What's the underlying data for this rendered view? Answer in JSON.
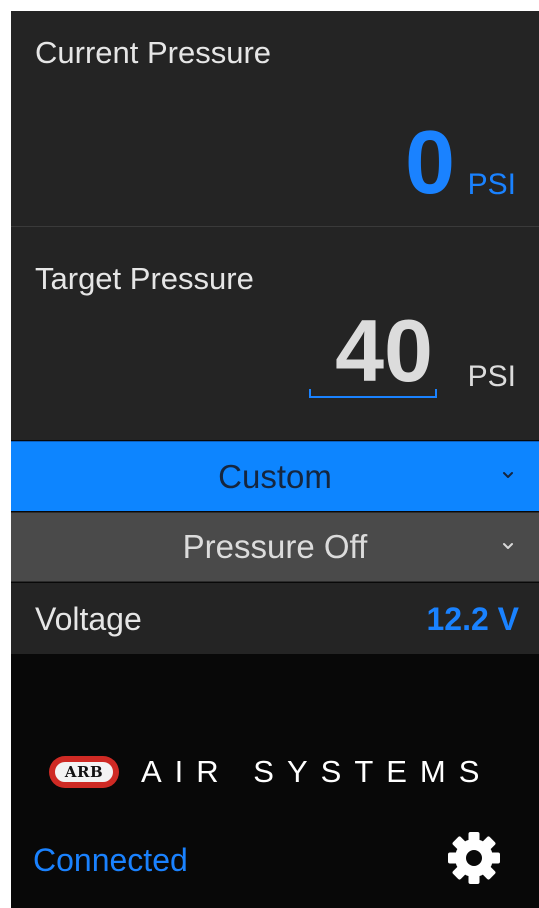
{
  "current_pressure": {
    "label": "Current Pressure",
    "value": "0",
    "unit": "PSI"
  },
  "target_pressure": {
    "label": "Target Pressure",
    "value": "40",
    "unit": "PSI"
  },
  "preset_dropdown": {
    "selected": "Custom",
    "icon": "chevron-down-icon"
  },
  "mode_dropdown": {
    "selected": "Pressure Off",
    "icon": "chevron-down-icon"
  },
  "voltage": {
    "label": "Voltage",
    "value": "12.2 V"
  },
  "brand": {
    "badge": "ARB",
    "text": "AIR SYSTEMS"
  },
  "connection": {
    "status": "Connected"
  },
  "settings": {
    "icon": "gear-icon"
  },
  "colors": {
    "accent": "#1a82ff",
    "panel": "#242424",
    "background": "#080808",
    "logo_red": "#cf2a24"
  }
}
